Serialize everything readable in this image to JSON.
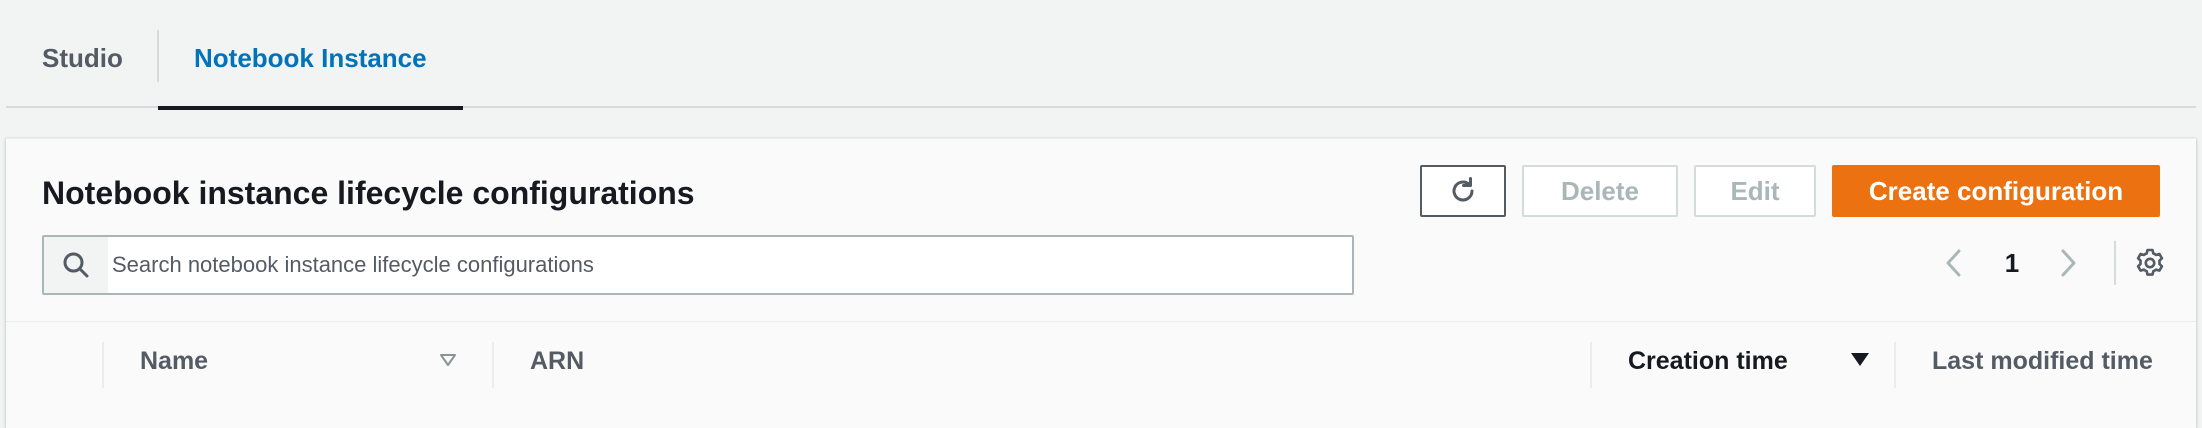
{
  "tabs": [
    {
      "label": "Studio"
    },
    {
      "label": "Notebook Instance"
    }
  ],
  "panel": {
    "title": "Notebook instance lifecycle configurations",
    "buttons": {
      "delete": "Delete",
      "edit": "Edit",
      "create": "Create configuration"
    },
    "search": {
      "placeholder": "Search notebook instance lifecycle configurations",
      "value": ""
    },
    "pagination": {
      "current_page": "1"
    }
  },
  "table": {
    "columns": [
      {
        "label": "Name",
        "sort": "unsorted"
      },
      {
        "label": "ARN"
      },
      {
        "label": "Creation time",
        "sort": "descending"
      },
      {
        "label": "Last modified time"
      }
    ],
    "rows": []
  },
  "colors": {
    "accent": "#0073bb",
    "primary_button": "#ec7211",
    "disabled_text": "#aab7b8"
  }
}
